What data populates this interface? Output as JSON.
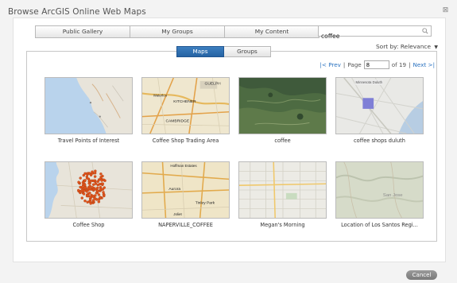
{
  "dialog": {
    "title": "Browse ArcGIS Online Web Maps",
    "close_glyph": "⊠"
  },
  "tabs": [
    {
      "label": "Public Gallery"
    },
    {
      "label": "My Groups"
    },
    {
      "label": "My Content"
    }
  ],
  "search": {
    "value": "coffee",
    "icon": "search-icon"
  },
  "sort": {
    "label": "Sort by:",
    "value": "Relevance",
    "caret": "▼"
  },
  "view_toggle": {
    "maps": "Maps",
    "groups": "Groups",
    "active": "Maps"
  },
  "pager": {
    "prev": "|< Prev",
    "sep1": "|",
    "page_label": "Page",
    "page_value": "8",
    "of": "of 19",
    "sep2": "|",
    "next": "Next >|"
  },
  "cards": [
    {
      "caption": "Travel Points of Interest"
    },
    {
      "caption": "Coffee Shop Trading Area"
    },
    {
      "caption": "coffee"
    },
    {
      "caption": "coffee shops duluth"
    },
    {
      "caption": "Coffee Shop"
    },
    {
      "caption": "NAPERVILLE_COFFEE"
    },
    {
      "caption": "Megan's Morning"
    },
    {
      "caption": "Location of Los Santos Regi..."
    }
  ],
  "map_labels": {
    "guelph": "GUELPH",
    "waterloo": "Waterloo",
    "kitchener": "KITCHENER",
    "cambridge": "CAMBRIDGE",
    "minnesota_duluth": "Minnesota Duluth",
    "hoffman_estates": "Hoffman Estates",
    "aurora": "Aurora",
    "tinley_park": "Tinley Park",
    "joliet": "Joliet",
    "san_jose": "San Jose"
  },
  "buttons": {
    "cancel": "Cancel"
  },
  "colors": {
    "accent": "#2563a3",
    "link": "#2a72c0",
    "marker": "#e0541c"
  }
}
